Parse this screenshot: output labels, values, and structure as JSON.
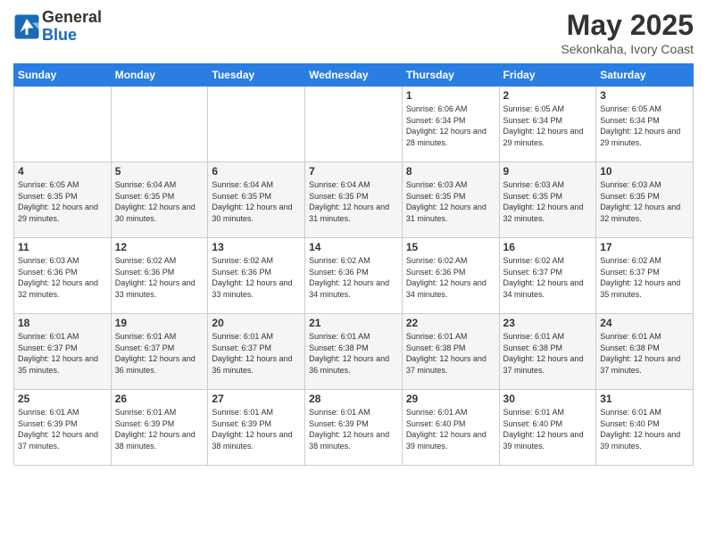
{
  "logo": {
    "general": "General",
    "blue": "Blue"
  },
  "title": "May 2025",
  "subtitle": "Sekonkaha, Ivory Coast",
  "days_of_week": [
    "Sunday",
    "Monday",
    "Tuesday",
    "Wednesday",
    "Thursday",
    "Friday",
    "Saturday"
  ],
  "weeks": [
    [
      {
        "day": "",
        "info": ""
      },
      {
        "day": "",
        "info": ""
      },
      {
        "day": "",
        "info": ""
      },
      {
        "day": "",
        "info": ""
      },
      {
        "day": "1",
        "info": "Sunrise: 6:06 AM\nSunset: 6:34 PM\nDaylight: 12 hours and 28 minutes."
      },
      {
        "day": "2",
        "info": "Sunrise: 6:05 AM\nSunset: 6:34 PM\nDaylight: 12 hours and 29 minutes."
      },
      {
        "day": "3",
        "info": "Sunrise: 6:05 AM\nSunset: 6:34 PM\nDaylight: 12 hours and 29 minutes."
      }
    ],
    [
      {
        "day": "4",
        "info": "Sunrise: 6:05 AM\nSunset: 6:35 PM\nDaylight: 12 hours and 29 minutes."
      },
      {
        "day": "5",
        "info": "Sunrise: 6:04 AM\nSunset: 6:35 PM\nDaylight: 12 hours and 30 minutes."
      },
      {
        "day": "6",
        "info": "Sunrise: 6:04 AM\nSunset: 6:35 PM\nDaylight: 12 hours and 30 minutes."
      },
      {
        "day": "7",
        "info": "Sunrise: 6:04 AM\nSunset: 6:35 PM\nDaylight: 12 hours and 31 minutes."
      },
      {
        "day": "8",
        "info": "Sunrise: 6:03 AM\nSunset: 6:35 PM\nDaylight: 12 hours and 31 minutes."
      },
      {
        "day": "9",
        "info": "Sunrise: 6:03 AM\nSunset: 6:35 PM\nDaylight: 12 hours and 32 minutes."
      },
      {
        "day": "10",
        "info": "Sunrise: 6:03 AM\nSunset: 6:35 PM\nDaylight: 12 hours and 32 minutes."
      }
    ],
    [
      {
        "day": "11",
        "info": "Sunrise: 6:03 AM\nSunset: 6:36 PM\nDaylight: 12 hours and 32 minutes."
      },
      {
        "day": "12",
        "info": "Sunrise: 6:02 AM\nSunset: 6:36 PM\nDaylight: 12 hours and 33 minutes."
      },
      {
        "day": "13",
        "info": "Sunrise: 6:02 AM\nSunset: 6:36 PM\nDaylight: 12 hours and 33 minutes."
      },
      {
        "day": "14",
        "info": "Sunrise: 6:02 AM\nSunset: 6:36 PM\nDaylight: 12 hours and 34 minutes."
      },
      {
        "day": "15",
        "info": "Sunrise: 6:02 AM\nSunset: 6:36 PM\nDaylight: 12 hours and 34 minutes."
      },
      {
        "day": "16",
        "info": "Sunrise: 6:02 AM\nSunset: 6:37 PM\nDaylight: 12 hours and 34 minutes."
      },
      {
        "day": "17",
        "info": "Sunrise: 6:02 AM\nSunset: 6:37 PM\nDaylight: 12 hours and 35 minutes."
      }
    ],
    [
      {
        "day": "18",
        "info": "Sunrise: 6:01 AM\nSunset: 6:37 PM\nDaylight: 12 hours and 35 minutes."
      },
      {
        "day": "19",
        "info": "Sunrise: 6:01 AM\nSunset: 6:37 PM\nDaylight: 12 hours and 36 minutes."
      },
      {
        "day": "20",
        "info": "Sunrise: 6:01 AM\nSunset: 6:37 PM\nDaylight: 12 hours and 36 minutes."
      },
      {
        "day": "21",
        "info": "Sunrise: 6:01 AM\nSunset: 6:38 PM\nDaylight: 12 hours and 36 minutes."
      },
      {
        "day": "22",
        "info": "Sunrise: 6:01 AM\nSunset: 6:38 PM\nDaylight: 12 hours and 37 minutes."
      },
      {
        "day": "23",
        "info": "Sunrise: 6:01 AM\nSunset: 6:38 PM\nDaylight: 12 hours and 37 minutes."
      },
      {
        "day": "24",
        "info": "Sunrise: 6:01 AM\nSunset: 6:38 PM\nDaylight: 12 hours and 37 minutes."
      }
    ],
    [
      {
        "day": "25",
        "info": "Sunrise: 6:01 AM\nSunset: 6:39 PM\nDaylight: 12 hours and 37 minutes."
      },
      {
        "day": "26",
        "info": "Sunrise: 6:01 AM\nSunset: 6:39 PM\nDaylight: 12 hours and 38 minutes."
      },
      {
        "day": "27",
        "info": "Sunrise: 6:01 AM\nSunset: 6:39 PM\nDaylight: 12 hours and 38 minutes."
      },
      {
        "day": "28",
        "info": "Sunrise: 6:01 AM\nSunset: 6:39 PM\nDaylight: 12 hours and 38 minutes."
      },
      {
        "day": "29",
        "info": "Sunrise: 6:01 AM\nSunset: 6:40 PM\nDaylight: 12 hours and 39 minutes."
      },
      {
        "day": "30",
        "info": "Sunrise: 6:01 AM\nSunset: 6:40 PM\nDaylight: 12 hours and 39 minutes."
      },
      {
        "day": "31",
        "info": "Sunrise: 6:01 AM\nSunset: 6:40 PM\nDaylight: 12 hours and 39 minutes."
      }
    ]
  ]
}
